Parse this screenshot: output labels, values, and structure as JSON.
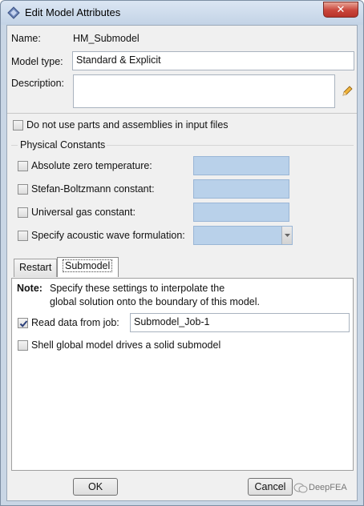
{
  "window": {
    "title": "Edit Model Attributes",
    "close_label": "✕"
  },
  "form": {
    "name_label": "Name:",
    "name_value": "HM_Submodel",
    "model_type_label": "Model type:",
    "model_type_value": "Standard & Explicit",
    "description_label": "Description:",
    "description_value": "",
    "no_parts_label": "Do not use parts and assemblies in input files",
    "no_parts_checked": false
  },
  "physical_constants": {
    "group_label": "Physical Constants",
    "items": [
      {
        "label": "Absolute zero temperature:",
        "checked": false,
        "value": ""
      },
      {
        "label": "Stefan-Boltzmann constant:",
        "checked": false,
        "value": ""
      },
      {
        "label": "Universal gas constant:",
        "checked": false,
        "value": ""
      },
      {
        "label": "Specify acoustic wave formulation:",
        "checked": false,
        "value": ""
      }
    ]
  },
  "tabs": [
    {
      "label": "Restart",
      "active": false
    },
    {
      "label": "Submodel",
      "active": true
    }
  ],
  "submodel": {
    "note_label": "Note:",
    "note_line1": "Specify these settings to interpolate the",
    "note_line2": "global solution onto the boundary of this model.",
    "read_data_label": "Read data from job:",
    "read_data_checked": true,
    "job_value": "Submodel_Job-1",
    "shell_global_label": "Shell global model drives a solid submodel",
    "shell_global_checked": false
  },
  "buttons": {
    "ok": "OK",
    "cancel": "Cancel"
  },
  "watermark": "DeepFEA"
}
